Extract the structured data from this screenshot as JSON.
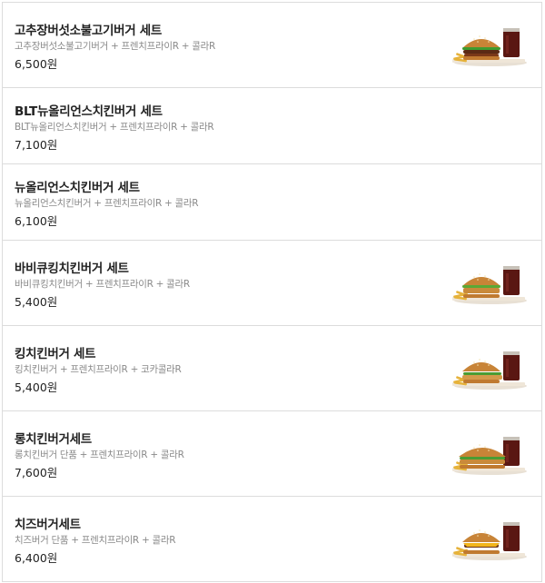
{
  "menu": {
    "items": [
      {
        "name": "고추장버섯소불고기버거 세트",
        "desc": "고추장버섯소불고기버거 + 프렌치프라이R + 콜라R",
        "price": "6,500원",
        "has_image": true
      },
      {
        "name": "BLT뉴올리언스치킨버거 세트",
        "desc": "BLT뉴올리언스치킨버거 + 프렌치프라이R + 콜라R",
        "price": "7,100원",
        "has_image": false
      },
      {
        "name": "뉴올리언스치킨버거 세트",
        "desc": "뉴올리언스치킨버거 + 프렌치프라이R + 콜라R",
        "price": "6,100원",
        "has_image": false
      },
      {
        "name": "바비큐킹치킨버거 세트",
        "desc": "바비큐킹치킨버거 + 프렌치프라이R + 콜라R",
        "price": "5,400원",
        "has_image": true
      },
      {
        "name": "킹치킨버거 세트",
        "desc": "킹치킨버거 + 프렌치프라이R + 코카콜라R",
        "price": "5,400원",
        "has_image": true
      },
      {
        "name": "롱치킨버거세트",
        "desc": "롱치킨버거 단품 + 프렌치프라이R + 콜라R",
        "price": "7,600원",
        "has_image": true
      },
      {
        "name": "치즈버거세트",
        "desc": "치즈버거 단품 + 프렌치프라이R + 콜라R",
        "price": "6,400원",
        "has_image": true
      }
    ]
  }
}
